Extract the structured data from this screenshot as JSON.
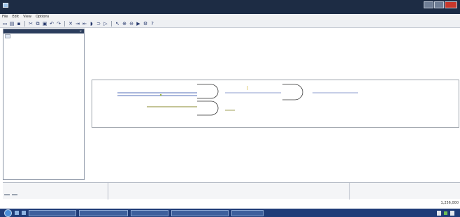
{
  "window": {
    "title": "",
    "accent": "#1d2c44",
    "close_color": "#c8382c"
  },
  "menu": {
    "items": [
      "File",
      "Edit",
      "View",
      "Options"
    ]
  },
  "toolbar": {
    "icons": [
      "new-file-icon",
      "open-folder-icon",
      "save-icon",
      "cut-icon",
      "copy-icon",
      "paste-icon",
      "undo-icon",
      "redo-icon",
      "delete-icon",
      "add-input-icon",
      "add-output-icon",
      "and-gate-icon",
      "or-gate-icon",
      "not-gate-icon",
      "select-icon",
      "zoom-in-icon",
      "zoom-out-icon",
      "simulate-icon",
      "settings-icon",
      "help-icon"
    ]
  },
  "left_panel": {
    "title": "",
    "tabs": [
      ""
    ],
    "tree": [
      {
        "label": "",
        "level": 0
      },
      {
        "label": "",
        "level": 1
      }
    ]
  },
  "circuit": {
    "wire_color": "#1b3fa0",
    "inputs": [
      "",
      "",
      ""
    ],
    "output": "",
    "gates": [
      "",
      "",
      ""
    ]
  },
  "bottom": {
    "left_label": "",
    "mid_heading": "",
    "mid_subheading": "",
    "right_heading": "",
    "right_subheading": "",
    "tabs": [
      "",
      ""
    ],
    "zoom": "1,256,000"
  },
  "taskbar": {
    "buttons": [
      "",
      "",
      "",
      "",
      ""
    ],
    "tray": [
      "",
      ""
    ],
    "clock": ""
  }
}
